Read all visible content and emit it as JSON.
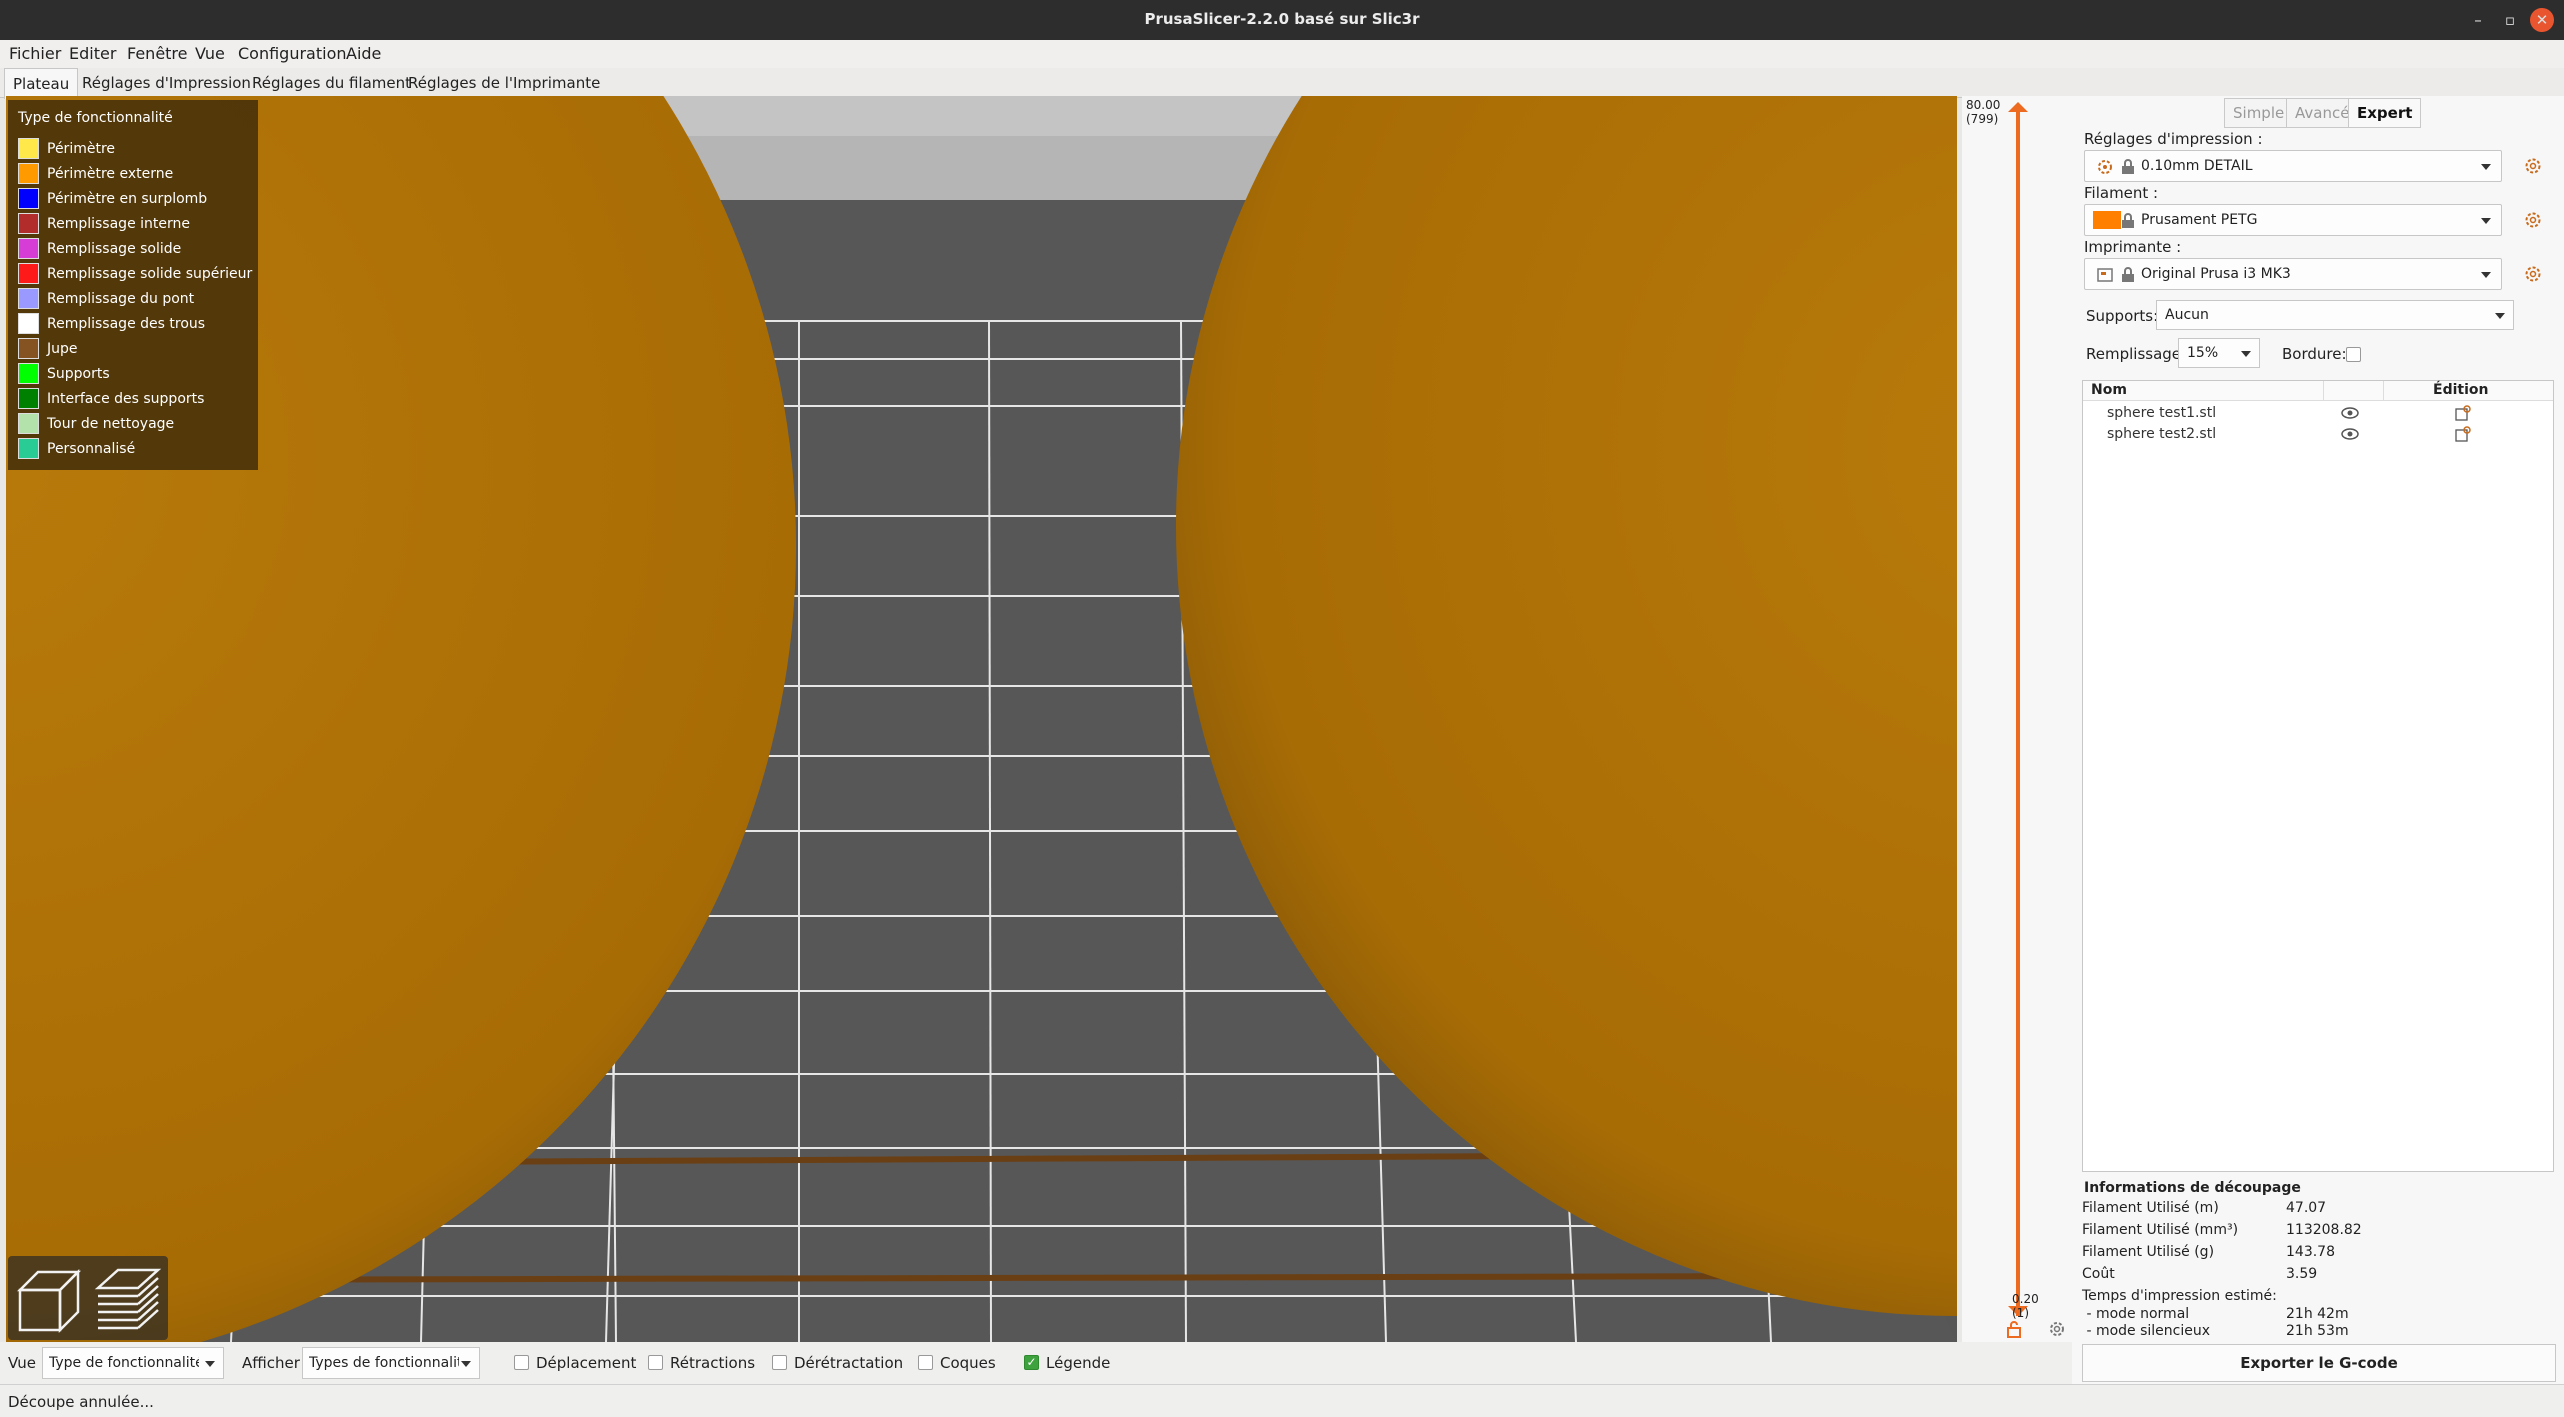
{
  "window": {
    "title": "PrusaSlicer-2.2.0 basé sur Slic3r",
    "min": "–",
    "max": "▫",
    "close": "✕"
  },
  "menu": [
    "Fichier",
    "Editer",
    "Fenêtre",
    "Vue",
    "Configuration",
    "Aide"
  ],
  "tabs": [
    "Plateau",
    "Réglages d'Impression",
    "Réglages du filament",
    "Réglages de l'Imprimante"
  ],
  "legend": {
    "title": "Type de fonctionnalité",
    "items": [
      {
        "label": "Périmètre",
        "color": "#ffe94a"
      },
      {
        "label": "Périmètre externe",
        "color": "#ff9a00"
      },
      {
        "label": "Périmètre en surplomb",
        "color": "#0000ff"
      },
      {
        "label": "Remplissage interne",
        "color": "#b22c2c"
      },
      {
        "label": "Remplissage solide",
        "color": "#d63cd6"
      },
      {
        "label": "Remplissage solide supérieur",
        "color": "#ff1a1a"
      },
      {
        "label": "Remplissage du pont",
        "color": "#9999ff"
      },
      {
        "label": "Remplissage des trous",
        "color": "#ffffff"
      },
      {
        "label": "Jupe",
        "color": "#845321"
      },
      {
        "label": "Supports",
        "color": "#00ff00"
      },
      {
        "label": "Interface des supports",
        "color": "#008000"
      },
      {
        "label": "Tour de nettoyage",
        "color": "#b3e3ab"
      },
      {
        "label": "Personnalisé",
        "color": "#28cc94"
      }
    ]
  },
  "slider": {
    "top_value": "80.00",
    "top_layer": "(799)",
    "bottom_value": "0.20",
    "bottom_layer": "(1)"
  },
  "mode": {
    "simple": "Simple",
    "advanced": "Avancé",
    "expert": "Expert"
  },
  "print_settings": {
    "label": "Réglages d'impression :",
    "value": "0.10mm DETAIL"
  },
  "filament": {
    "label": "Filament :",
    "value": "Prusament PETG",
    "color": "#ff8000"
  },
  "printer": {
    "label": "Imprimante :",
    "value": "Original Prusa i3 MK3"
  },
  "supports": {
    "label": "Supports:",
    "value": "Aucun"
  },
  "infill": {
    "label": "Remplissage:",
    "value": "15%"
  },
  "brim": {
    "label": "Bordure:"
  },
  "objects": {
    "col_name": "Nom",
    "col_edit": "Édition",
    "rows": [
      {
        "name": "sphere test1.stl"
      },
      {
        "name": "sphere test2.stl"
      }
    ]
  },
  "slice_info": {
    "title": "Informations de découpage",
    "rows": [
      {
        "k": "Filament Utilisé (m)",
        "v": "47.07"
      },
      {
        "k": "Filament Utilisé (mm³)",
        "v": "113208.82"
      },
      {
        "k": "Filament Utilisé (g)",
        "v": "143.78"
      },
      {
        "k": "Coût",
        "v": "3.59"
      },
      {
        "k": "Temps d'impression estimé:",
        "v": ""
      },
      {
        "k": " - mode normal",
        "v": "21h 42m"
      },
      {
        "k": " - mode silencieux",
        "v": "21h 53m"
      }
    ]
  },
  "export_label": "Exporter le G-code",
  "bottom": {
    "view_label": "Vue",
    "view_value": "Type de fonctionnalité",
    "show_label": "Afficher",
    "show_value": "Types de fonctionnalit",
    "checks": [
      {
        "label": "Déplacement",
        "checked": false
      },
      {
        "label": "Rétractions",
        "checked": false
      },
      {
        "label": "Dérétractation",
        "checked": false
      },
      {
        "label": "Coques",
        "checked": false
      },
      {
        "label": "Légende",
        "checked": true
      }
    ]
  },
  "status": "Découpe annulée..."
}
